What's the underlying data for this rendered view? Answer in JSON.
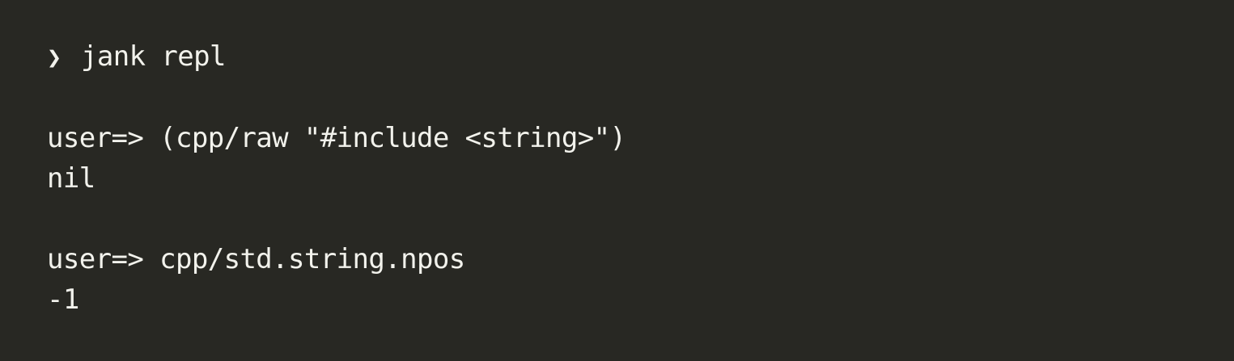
{
  "terminal": {
    "shell_prompt_symbol": "❯",
    "shell_command": "jank repl",
    "entries": [
      {
        "prompt": "user=>",
        "input": "(cpp/raw \"#include <string>\")",
        "output": "nil"
      },
      {
        "prompt": "user=>",
        "input": "cpp/std.string.npos",
        "output": "-1"
      }
    ]
  },
  "colors": {
    "background": "#282823",
    "foreground": "#f2f2ec"
  }
}
